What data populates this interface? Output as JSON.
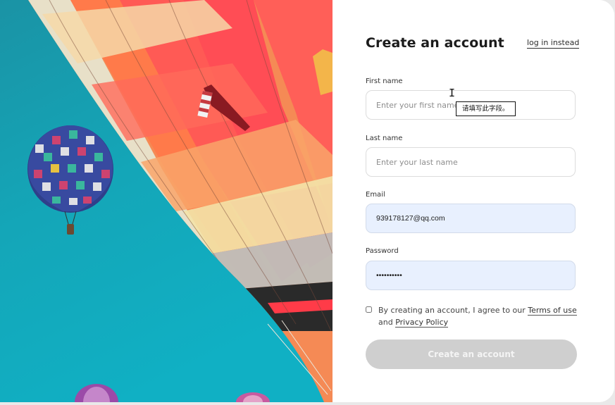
{
  "form": {
    "title": "Create an account",
    "login_link": "log in instead",
    "first_name": {
      "label": "First name",
      "placeholder": "Enter your first name",
      "value": ""
    },
    "last_name": {
      "label": "Last name",
      "placeholder": "Enter your last name",
      "value": ""
    },
    "email": {
      "label": "Email",
      "value": "939178127@qq.com"
    },
    "password": {
      "label": "Password",
      "value": "••••••••••"
    },
    "agree": {
      "checked": false,
      "text_prefix": "By creating an account, I agree to our",
      "terms_link": "Terms of use",
      "and": "and",
      "privacy_link": "Privacy Policy"
    },
    "submit_label": "Create an account"
  },
  "tooltip": {
    "text": "请填写此字段。"
  },
  "cursor": {
    "icon": "text-cursor-icon"
  },
  "colors": {
    "sky": "#16a3b3",
    "autofill_bg": "#e8f0fe",
    "submit_disabled": "#cfcfcf"
  }
}
